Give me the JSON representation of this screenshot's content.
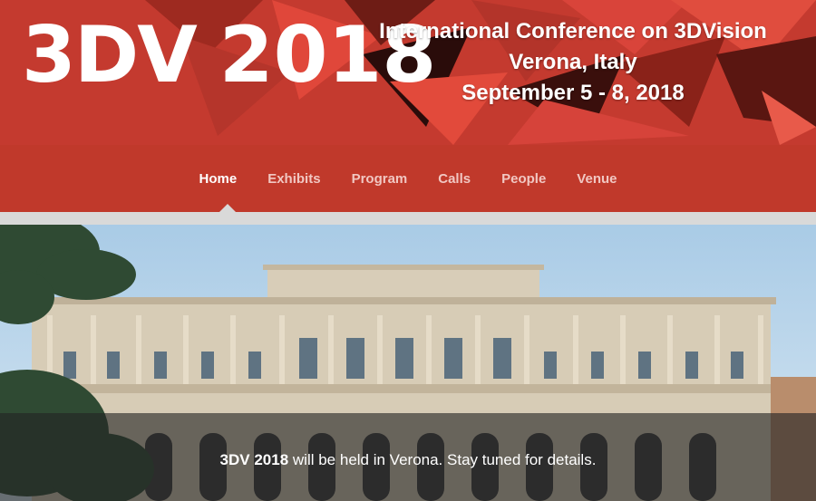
{
  "header": {
    "logo_abbr": "3DV",
    "logo_year": "2018",
    "conference_name": "International Conference on 3DVision",
    "location": "Verona, Italy",
    "dates": "September 5 - 8, 2018"
  },
  "nav": {
    "items": [
      {
        "label": "Home",
        "active": true
      },
      {
        "label": "Exhibits"
      },
      {
        "label": "Program"
      },
      {
        "label": "Calls"
      },
      {
        "label": "People"
      },
      {
        "label": "Venue"
      }
    ]
  },
  "hero": {
    "announcement_bold": "3DV 2018",
    "announcement_rest": " will be held in Verona. Stay tuned for details."
  },
  "colors": {
    "brand_red": "#c0392b",
    "nav_inactive": "#f1c7c2",
    "stripe_gray": "#d9d9d9"
  }
}
